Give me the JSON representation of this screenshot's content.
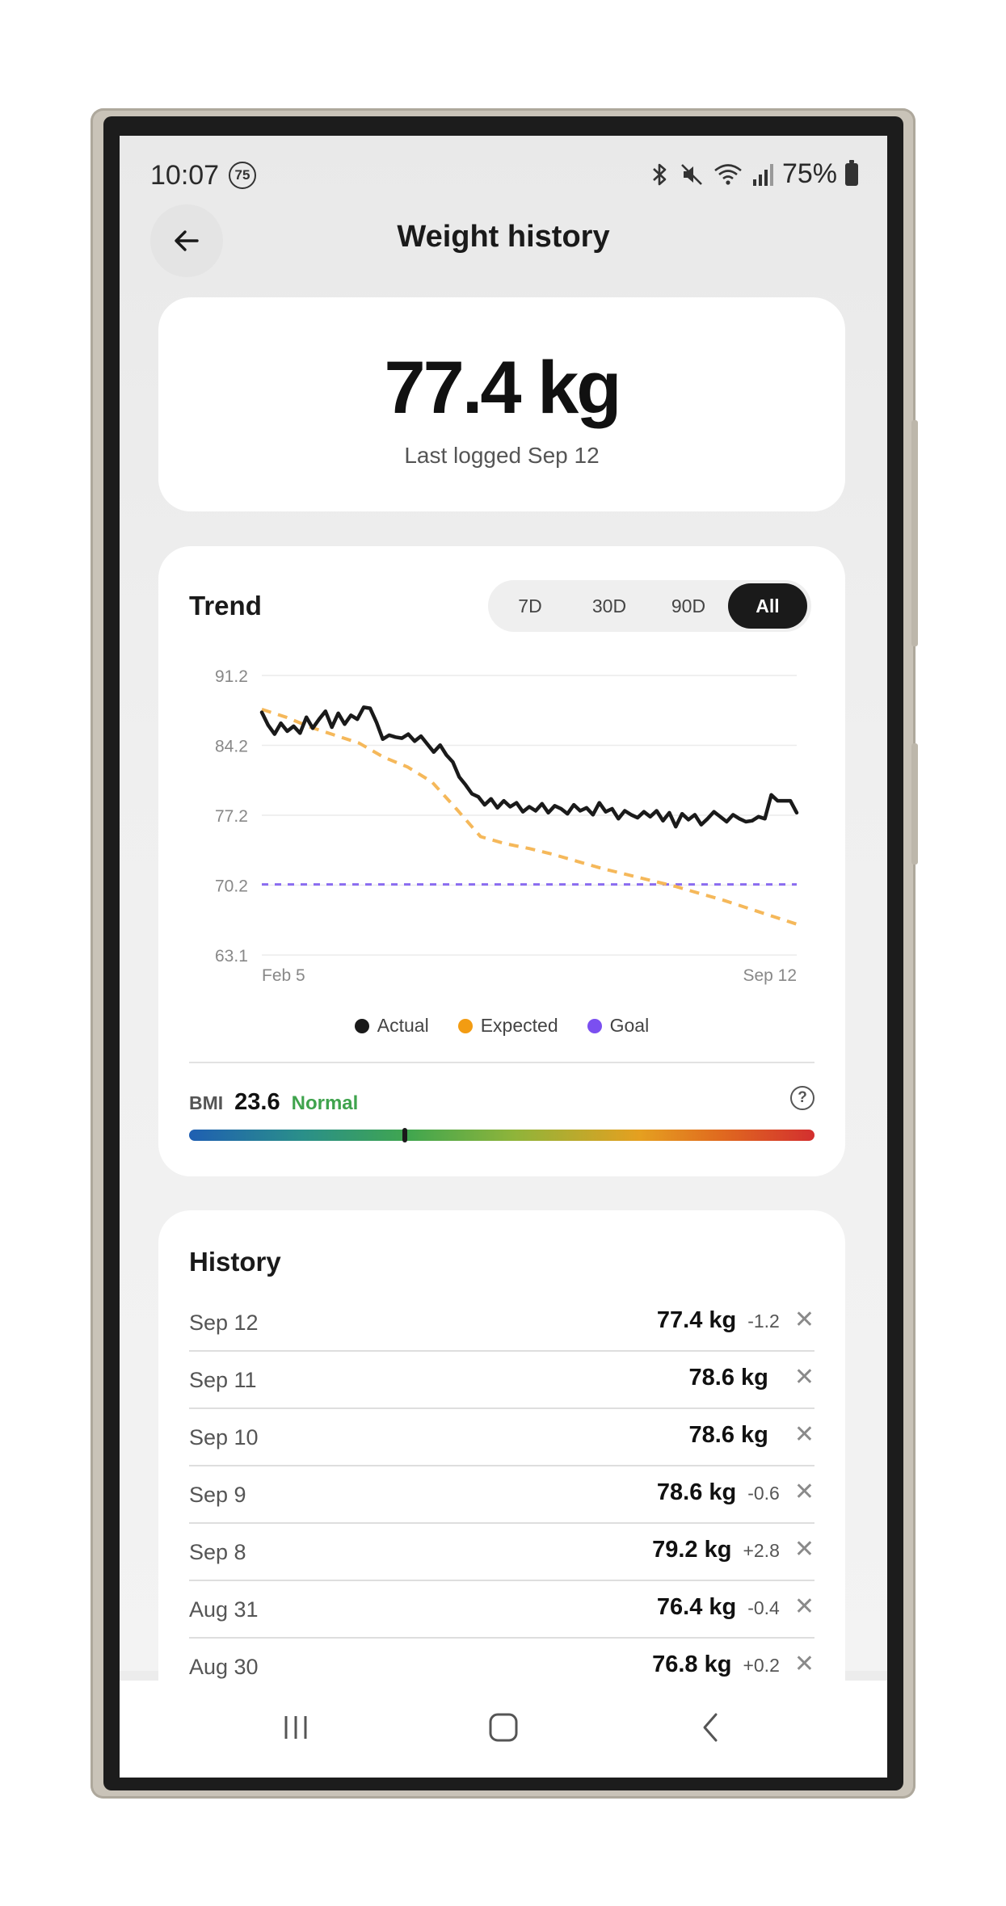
{
  "status_bar": {
    "time": "10:07",
    "notification_badge": "75",
    "battery_percent": "75%",
    "icons": [
      "bluetooth-icon",
      "mute-icon",
      "wifi-icon",
      "signal-icon",
      "battery-icon"
    ]
  },
  "header": {
    "title": "Weight history",
    "back_icon": "arrow-left-icon"
  },
  "summary": {
    "current_weight": "77.4 kg",
    "last_logged": "Last logged Sep 12"
  },
  "trend": {
    "title": "Trend",
    "ranges": [
      "7D",
      "30D",
      "90D",
      "All"
    ],
    "selected_range": "All",
    "legend": [
      {
        "label": "Actual",
        "color": "#1a1a1a"
      },
      {
        "label": "Expected",
        "color": "#f39c12"
      },
      {
        "label": "Goal",
        "color": "#7b4ff0"
      }
    ]
  },
  "chart_data": {
    "type": "line",
    "y_ticks": [
      "91.2",
      "84.2",
      "77.2",
      "70.2",
      "63.1"
    ],
    "x_labels": [
      "Feb 5",
      "Sep 12"
    ],
    "ylim": [
      63.1,
      91.2
    ],
    "grid": true,
    "legend_position": "bottom",
    "series": [
      {
        "name": "Actual",
        "color": "#1a1a1a",
        "values": [
          87.5,
          86.2,
          85.3,
          86.4,
          85.6,
          86.1,
          85.4,
          87.0,
          85.9,
          86.8,
          87.6,
          86.0,
          87.4,
          86.3,
          87.2,
          86.8,
          88.0,
          87.9,
          86.5,
          84.8,
          85.2,
          85.0,
          84.9,
          85.3,
          84.6,
          85.1,
          84.3,
          83.5,
          84.2,
          83.2,
          82.5,
          81.0,
          80.2,
          79.3,
          79.0,
          78.2,
          78.8,
          77.9,
          78.6,
          78.0,
          78.4,
          77.5,
          78.0,
          77.6,
          78.3,
          77.4,
          78.1,
          77.8,
          77.3,
          78.2,
          77.6,
          77.9,
          77.2,
          78.4,
          77.5,
          77.8,
          76.8,
          77.6,
          77.2,
          76.9,
          77.5,
          77.0,
          77.6,
          76.6,
          77.4,
          76.0,
          77.3,
          76.7,
          77.2,
          76.2,
          76.8,
          77.5,
          77.0,
          76.5,
          77.2,
          76.8,
          76.5,
          76.6,
          77.0,
          76.8,
          79.2,
          78.6,
          78.6,
          78.6,
          77.4
        ]
      },
      {
        "name": "Expected",
        "color": "#f5b85a",
        "values": [
          87.8,
          87.0,
          86.0,
          85.2,
          84.4,
          83.0,
          82.0,
          80.5,
          77.8,
          75.0,
          74.3,
          73.8,
          73.2,
          72.5,
          71.8,
          71.2,
          70.6,
          70.0,
          69.3,
          68.6,
          67.8,
          67.0,
          66.2
        ]
      },
      {
        "name": "Goal",
        "color": "#8a6cf0",
        "values": [
          70.2,
          70.2
        ]
      }
    ]
  },
  "bmi": {
    "label": "BMI",
    "value": "23.6",
    "category": "Normal",
    "position_fraction": 0.345,
    "help_icon": "question-circle-icon"
  },
  "history": {
    "title": "History",
    "entries": [
      {
        "date": "Sep 12",
        "weight": "77.4 kg",
        "delta": "-1.2"
      },
      {
        "date": "Sep 11",
        "weight": "78.6 kg",
        "delta": ""
      },
      {
        "date": "Sep 10",
        "weight": "78.6 kg",
        "delta": ""
      },
      {
        "date": "Sep 9",
        "weight": "78.6 kg",
        "delta": "-0.6"
      },
      {
        "date": "Sep 8",
        "weight": "79.2 kg",
        "delta": "+2.8"
      },
      {
        "date": "Aug 31",
        "weight": "76.4 kg",
        "delta": "-0.4"
      },
      {
        "date": "Aug 30",
        "weight": "76.8 kg",
        "delta": "+0.2"
      }
    ]
  },
  "nav_bar": {
    "buttons": [
      "recents-icon",
      "home-icon",
      "back-icon"
    ]
  }
}
